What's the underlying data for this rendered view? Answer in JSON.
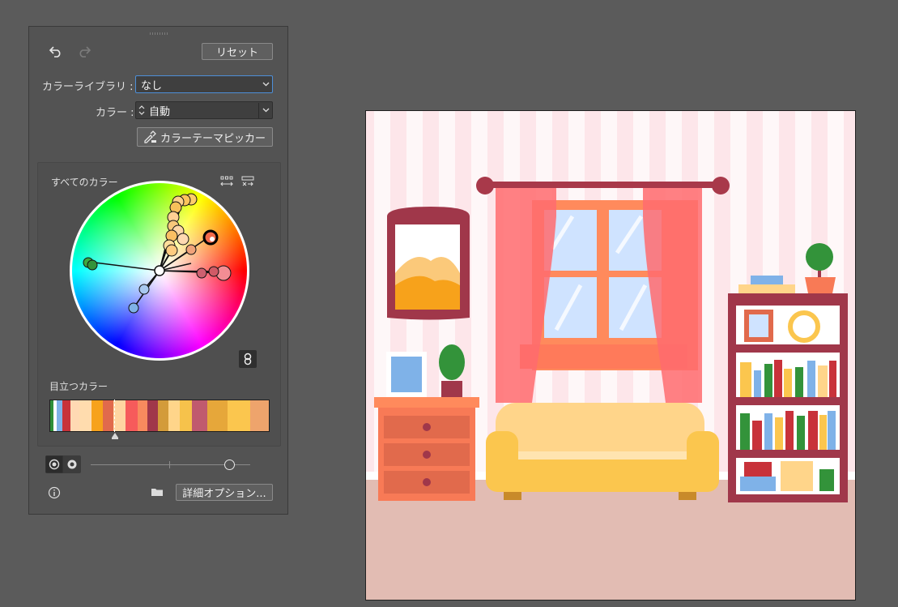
{
  "panel": {
    "reset_label": "リセット",
    "library_label": "カラーライブラリ :",
    "library_value": "なし",
    "color_label": "カラー :",
    "color_value": "自動",
    "picker_label": "カラーテーマピッカー",
    "all_colors_label": "すべてのカラー",
    "prominent_label": "目立つカラー",
    "advanced_label": "詳細オプション..."
  },
  "colors": {
    "panel_bg": "#535353",
    "accent_focus": "#4d8fd8"
  },
  "prominent_colors": [
    "#2f8f3a",
    "#ffffff",
    "#7fb2e8",
    "#c8323a",
    "#ffd9b3",
    "#ffdcae",
    "#f7a21b",
    "#e16a4c",
    "#ffd5a1",
    "#f65b5b",
    "#f88a5e",
    "#a0374a",
    "#d39b3a",
    "#ffd58a",
    "#f6c24b",
    "#c05a6e",
    "#e6a73a",
    "#fbc64e",
    "#eea46c"
  ],
  "prominent_widths": [
    4,
    4,
    6,
    10,
    10,
    14,
    14,
    12,
    14,
    14,
    12,
    12,
    12,
    14,
    14,
    18,
    24,
    26,
    22
  ]
}
